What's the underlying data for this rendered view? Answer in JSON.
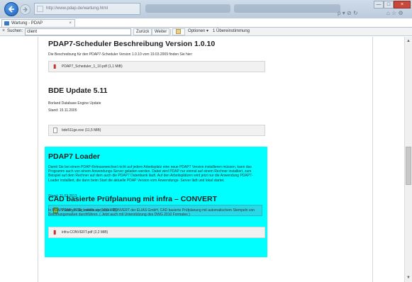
{
  "browser": {
    "url": "http://www.pdap.de/wartung.html",
    "tab_title": "Wartung - PDAP",
    "tab_close": "×",
    "window_controls": [
      "—",
      "□",
      "×"
    ],
    "toolbar_icons": "⌂ ☆ ⚙",
    "address_actions": "ρ ▾ ⊘ ↻"
  },
  "findbar": {
    "close": "×",
    "label": "Suchen:",
    "value": "client",
    "back_label": "Zurück",
    "forward_label": "Weiter",
    "options_label": "Optionen",
    "options_arrow": "▾",
    "match_count": "1 Übereinstimmung"
  },
  "content": {
    "scheduler": {
      "title": "PDAP7-Scheduler Beschreibung Version 1.0.10",
      "description": "Die Beschreibung für den PDAP7-Scheduler Version 1.0.10 vom 19.03.2009 finden Sie hier:",
      "file": "PDAP7_Scheduler_1_10.pdf (1,1 MiB)"
    },
    "bde": {
      "title": "BDE Update 5.11",
      "description": "Borland Database Engine Update",
      "date": "Stand: 15.11.2005",
      "file": "bde511ge.exe (11,5 MiB)"
    },
    "loader": {
      "title": "PDAP7 Loader",
      "description": "Damit Sie bei einem PDAP-Releasewechsel nicht auf jedem Arbeitsplatz eine neue PDAP7 Version installieren müssen, kann das Programm auch von einem Anwendungs-Server geladen werden. Dabei wird PDAP nur einmal auf einem Rechner installiert, zum Beispiel auf dem Rechner auf dem auch die PDAP7 Datenbank läuft. Auf den Arbeitsplätzen wird jetzt nur die Anwendung PDAP7-Loader installiert, die dann beim Start die aktuelle PDAP Version vom Anwendungs- Server lädt und lokal startet.",
      "date": "Stand: 11.02.2013",
      "file": "PDAP_7036_Loader.zip (10,0 MiB)"
    },
    "convert": {
      "title": "CAD basierte Prüfplanung mit infra – CONVERT",
      "description": "In PDAP7 können Sie mithilfe von infra - CONVERT der ELIAS GmbH, CAD basierte Prüfplanung mit automatischem Stempeln von Zeichnungsmaßen durchführen. ( Jetzt auch mit Unterstützung des DWG 2010 Formates )",
      "file": "infra-CONVERT.pdf (2,2 MiB)"
    }
  },
  "scrollbar": {
    "up": "▲",
    "down": "▼"
  },
  "colors": {
    "highlight": "#00ffff",
    "ie_blue": "#1d62b8"
  },
  "icons": [
    "back-arrow-icon",
    "forward-arrow-icon",
    "pdf-file-icon",
    "exe-file-icon",
    "zip-file-icon"
  ]
}
